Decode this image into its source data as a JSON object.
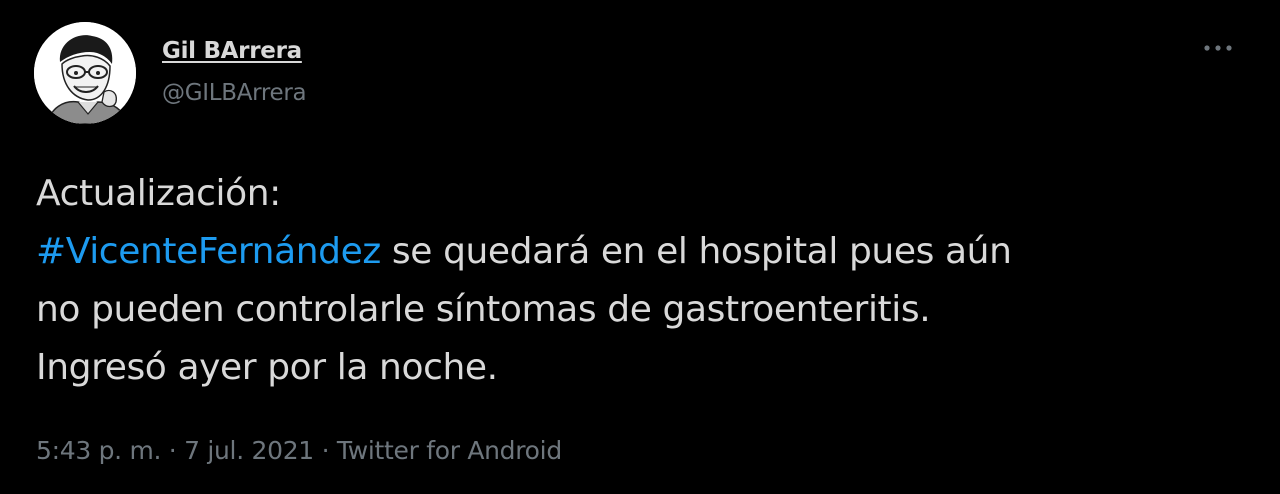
{
  "author": {
    "name": "Gil BArrera",
    "handle": "@GILBArrera"
  },
  "tweet": {
    "line1": "Actualización:",
    "hashtag": "#VicenteFernández",
    "line2_rest": " se quedará en el hospital pues aún",
    "line3": "no pueden controlarle síntomas de gastroenteritis.",
    "line4": "Ingresó ayer por la noche."
  },
  "meta": {
    "time": "5:43 p. m.",
    "sep1": " · ",
    "date": "7 jul. 2021",
    "sep2": " · ",
    "source": "Twitter for Android"
  },
  "icons": {
    "more": "more-options-icon"
  },
  "colors": {
    "background": "#000000",
    "text": "#d9d9d9",
    "secondary": "#6e767d",
    "link": "#1d9bf0"
  }
}
